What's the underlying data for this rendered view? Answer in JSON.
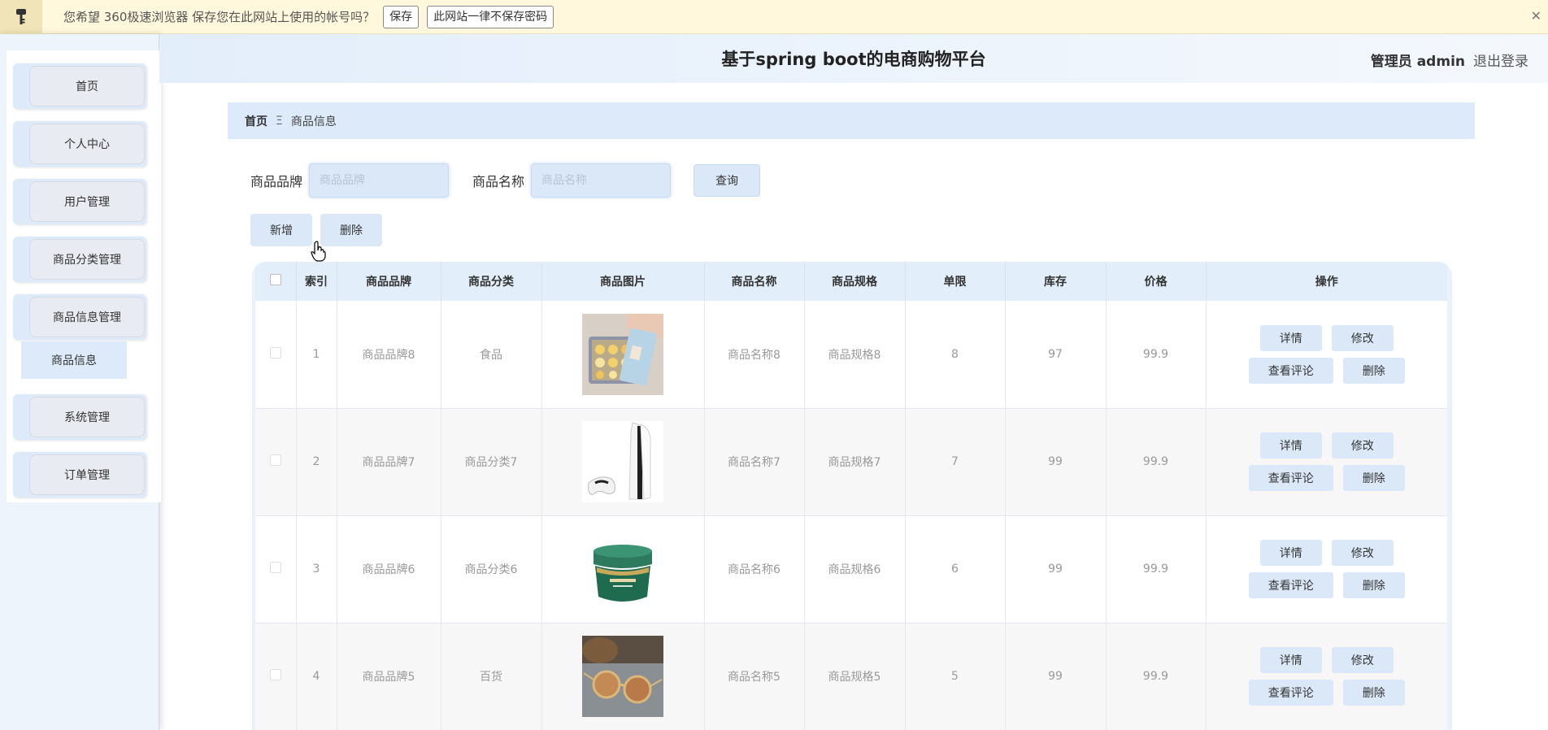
{
  "password_bar": {
    "prompt": "您希望 360极速浏览器 保存您在此网站上使用的帐号吗？",
    "save_label": "保存",
    "never_label": "此网站一律不保存密码",
    "close": "✕"
  },
  "sidebar": {
    "items": [
      {
        "label": "首页"
      },
      {
        "label": "个人中心"
      },
      {
        "label": "用户管理"
      },
      {
        "label": "商品分类管理"
      },
      {
        "label": "商品信息管理"
      },
      {
        "label": "系统管理"
      },
      {
        "label": "订单管理"
      }
    ],
    "submenu_label": "商品信息"
  },
  "header": {
    "title": "基于spring boot的电商购物平台",
    "user_label": "管理员 admin",
    "logout_label": "退出登录"
  },
  "breadcrumb": {
    "home": "首页",
    "separator": "Ξ",
    "current": "商品信息"
  },
  "search": {
    "brand_label": "商品品牌",
    "brand_placeholder": "商品品牌",
    "name_label": "商品名称",
    "name_placeholder": "商品名称",
    "query_label": "查询"
  },
  "actions": {
    "add_label": "新增",
    "delete_label": "删除"
  },
  "table": {
    "headers": {
      "index": "索引",
      "brand": "商品品牌",
      "category": "商品分类",
      "image": "商品图片",
      "name": "商品名称",
      "spec": "商品规格",
      "limit": "单限",
      "stock": "库存",
      "price": "价格",
      "ops": "操作"
    },
    "rows": [
      {
        "index": "1",
        "brand": "商品品牌8",
        "category": "食品",
        "image": "snack-box-image",
        "name": "商品名称8",
        "spec": "商品规格8",
        "limit": "8",
        "stock": "97",
        "price": "99.9"
      },
      {
        "index": "2",
        "brand": "商品品牌7",
        "category": "商品分类7",
        "image": "game-console-image",
        "name": "商品名称7",
        "spec": "商品规格7",
        "limit": "7",
        "stock": "99",
        "price": "99.9"
      },
      {
        "index": "3",
        "brand": "商品品牌6",
        "category": "商品分类6",
        "image": "cream-jar-image",
        "name": "商品名称6",
        "spec": "商品规格6",
        "limit": "6",
        "stock": "99",
        "price": "99.9"
      },
      {
        "index": "4",
        "brand": "商品品牌5",
        "category": "百货",
        "image": "sunglasses-image",
        "name": "商品名称5",
        "spec": "商品规格5",
        "limit": "5",
        "stock": "99",
        "price": "99.9"
      }
    ],
    "row_actions": {
      "detail": "详情",
      "edit": "修改",
      "comments": "查看评论",
      "delete": "删除"
    }
  }
}
